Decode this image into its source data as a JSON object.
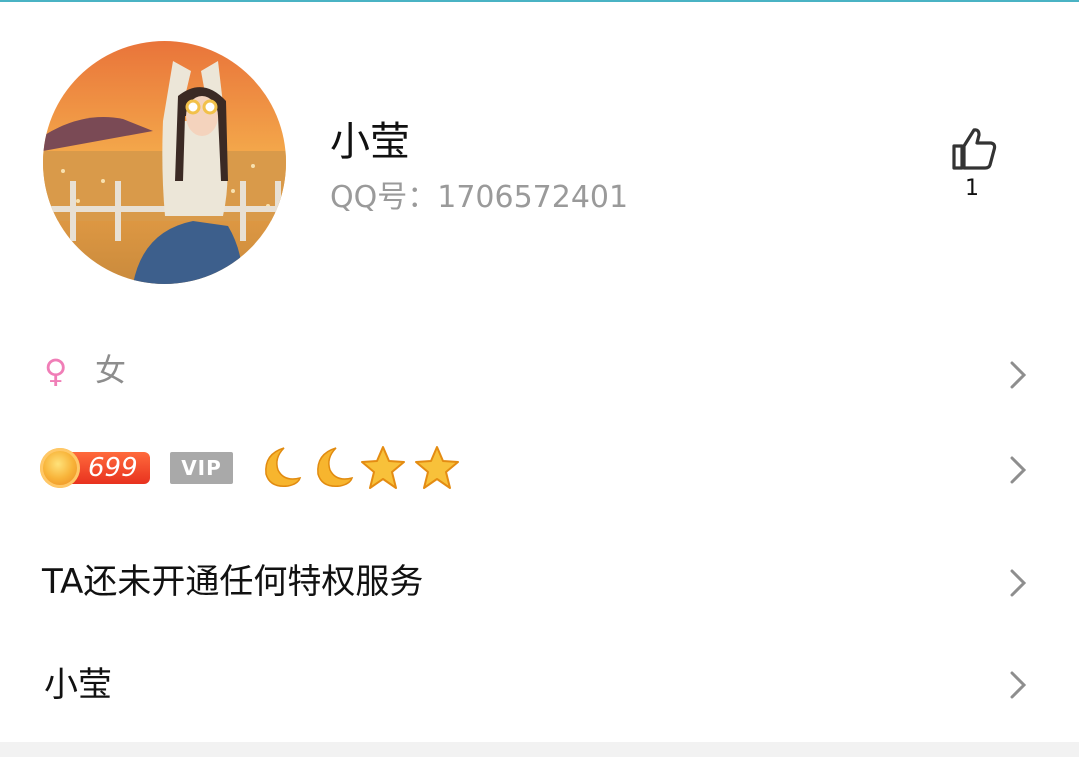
{
  "profile": {
    "name": "小莹",
    "qq_label": "QQ号：1706572401",
    "likes": "1"
  },
  "gender": {
    "symbol": "♀",
    "label": "女"
  },
  "level": {
    "number": "699",
    "vip_label": "VIP",
    "moons": 2,
    "stars": 2
  },
  "privilege": {
    "text": "TA还未开通任何特权服务"
  },
  "nickname": {
    "text": "小莹"
  },
  "colors": {
    "accent_line": "#4ab3c4",
    "gender_pink": "#f07eb7",
    "level_red": "#e8321f"
  }
}
